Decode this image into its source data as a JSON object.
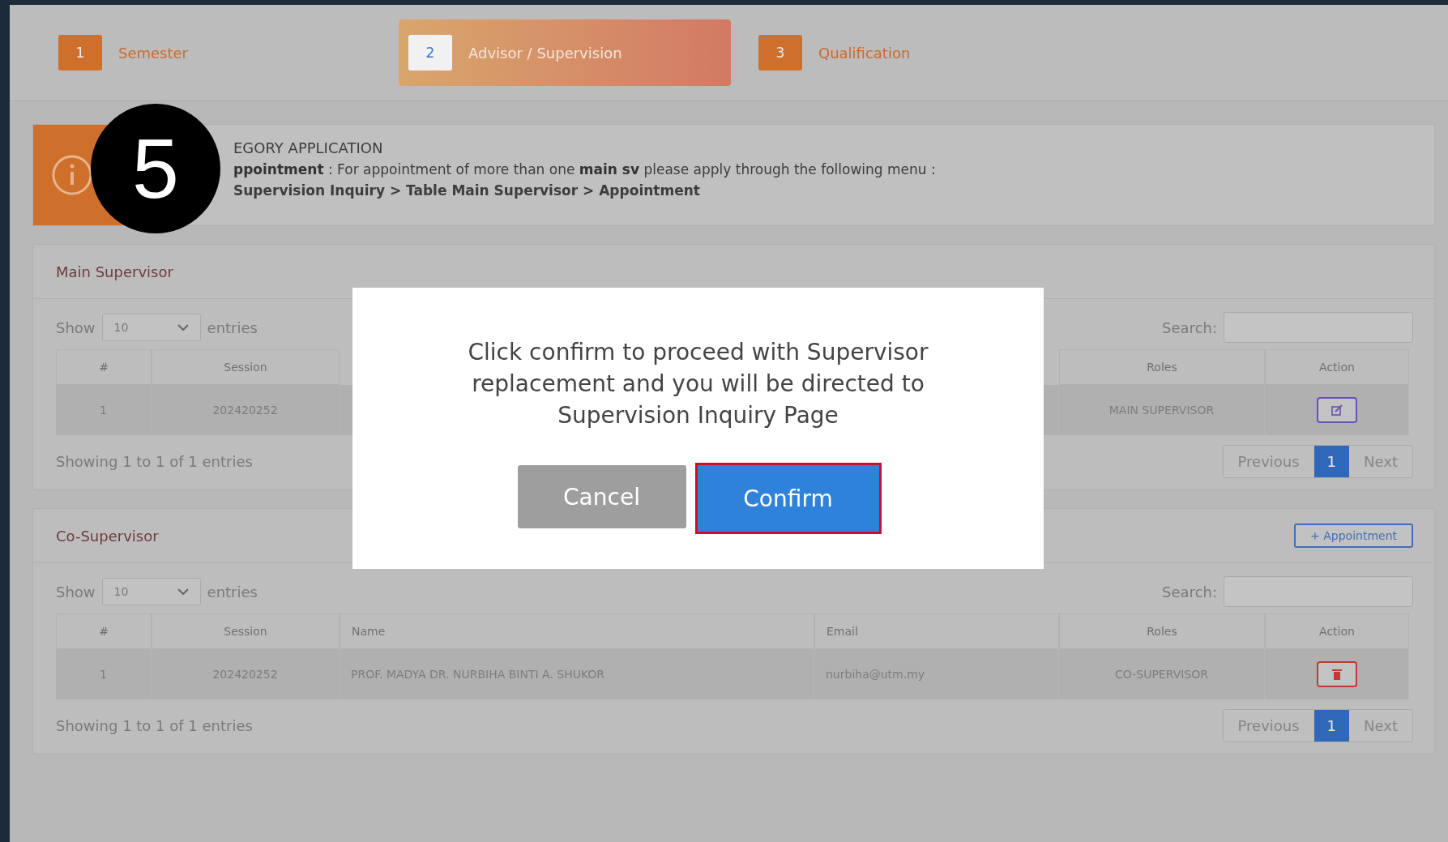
{
  "steps": [
    {
      "number": "1",
      "label": "Semester",
      "selected": false
    },
    {
      "number": "2",
      "label": "Advisor / Supervision",
      "selected": true
    },
    {
      "number": "3",
      "label": "Qualification",
      "selected": false
    }
  ],
  "notice": {
    "title": "EGORY APPLICATION",
    "text": "**ppointment** : For appointment of more than one **main sv** please apply through the following menu :",
    "path": "Supervision Inquiry > Table Main Supervisor > Appointment"
  },
  "step_marker": "5",
  "panels": [
    {
      "title": "Main Supervisor",
      "show_label": "Show",
      "page_size": "10",
      "entries_label": "entries",
      "search_label": "Search:",
      "columns": [
        "#",
        "Session",
        "Roles",
        "Action"
      ],
      "rows": [
        {
          "cells": [
            "1",
            "202420252",
            "MAIN SUPERVISOR"
          ],
          "kind": "edit"
        }
      ],
      "summary": "Showing 1 to 1 of 1 entries",
      "pagination": [
        {
          "label": "Previous",
          "selected": false
        },
        {
          "label": "1",
          "selected": true
        },
        {
          "label": "Next",
          "selected": false
        }
      ]
    },
    {
      "title": "Co-Supervisor",
      "add_button": "+ Appointment",
      "show_label": "Show",
      "page_size": "10",
      "entries_label": "entries",
      "search_label": "Search:",
      "columns": [
        "#",
        "Session",
        "Name",
        "Email",
        "Roles",
        "Action"
      ],
      "rows": [
        {
          "cells": [
            "1",
            "202420252",
            "PROF. MADYA DR. NURBIHA BINTI A. SHUKOR",
            "nurbiha@utm.my",
            "CO-SUPERVISOR"
          ],
          "kind": "delete"
        }
      ],
      "summary": "Showing 1 to 1 of 1 entries",
      "pagination": [
        {
          "label": "Previous",
          "selected": false
        },
        {
          "label": "1",
          "selected": true
        },
        {
          "label": "Next",
          "selected": false
        }
      ]
    }
  ],
  "modal": {
    "message": "Click confirm to proceed with Supervisor replacement and you will be directed to Supervision Inquiry Page",
    "buttons": [
      {
        "label": "Cancel",
        "kind": "cancel",
        "highlighted": false
      },
      {
        "label": "Confirm",
        "kind": "confirm",
        "highlighted": true
      }
    ]
  }
}
